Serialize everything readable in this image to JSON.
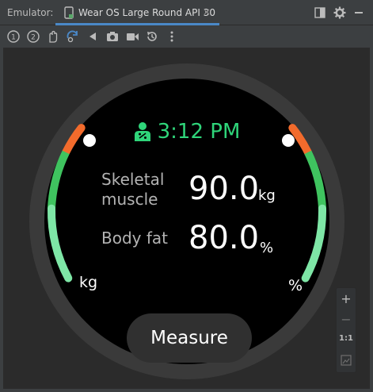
{
  "titlebar": {
    "label": "Emulator:",
    "tab_title": "Wear OS Large Round API 30",
    "tab_close": "×"
  },
  "toolbar": {
    "tools": [
      "power-icon",
      "volume-up-icon",
      "volume-down-icon",
      "rotate-icon",
      "back-icon",
      "camera-icon",
      "video-icon",
      "restore-icon",
      "more-icon"
    ]
  },
  "watch": {
    "time": "3:12 PM",
    "skeletal_label": [
      "Skeletal",
      "muscle"
    ],
    "skeletal_value": "90.0",
    "skeletal_unit": "kg",
    "bodyfat_label": "Body fat",
    "bodyfat_value": "80.0",
    "bodyfat_unit": "%",
    "left_gauge_unit": "kg",
    "right_gauge_unit": "%",
    "measure_label": "Measure"
  },
  "zoom": {
    "zoom_in": "+",
    "zoom_out": "−",
    "actual_size": "1:1"
  },
  "colors": {
    "accent": "#2fd57a",
    "gauge_orange": "#f26b2c",
    "gauge_green": "#3fc35f",
    "gauge_light_green": "#7ee6a6",
    "tab_underline": "#4a88c7"
  }
}
